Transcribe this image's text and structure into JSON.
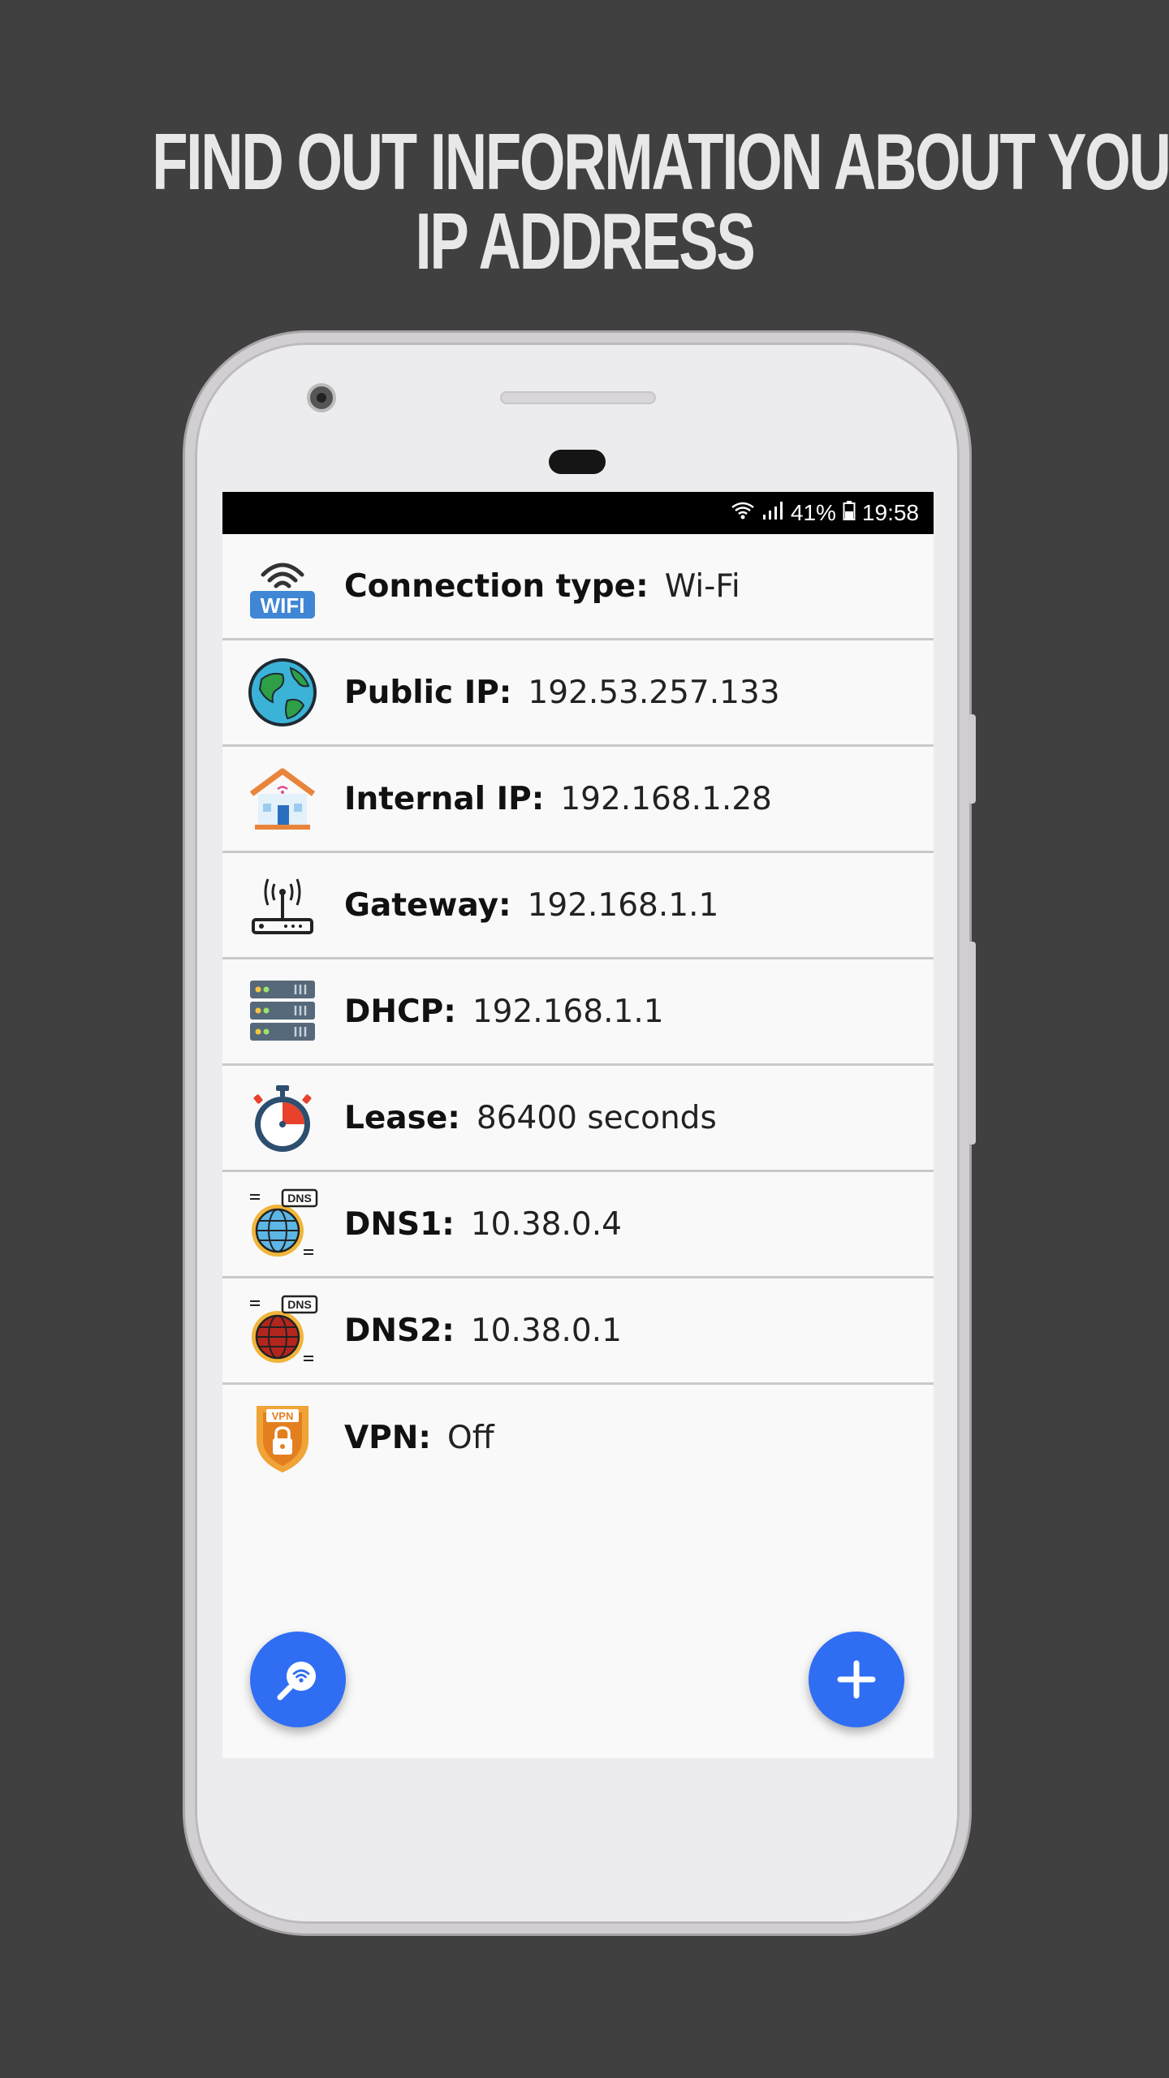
{
  "headline": {
    "line1": "FIND OUT INFORMATION ABOUT YOUR",
    "line2": "IP ADDRESS"
  },
  "status_bar": {
    "battery": "41%",
    "time": "19:58"
  },
  "rows": [
    {
      "icon": "wifi-icon",
      "label": "Connection type:",
      "value": "Wi-Fi"
    },
    {
      "icon": "globe-icon",
      "label": "Public IP:",
      "value": "192.53.257.133"
    },
    {
      "icon": "house-icon",
      "label": "Internal IP:",
      "value": "192.168.1.28"
    },
    {
      "icon": "router-icon",
      "label": "Gateway:",
      "value": "192.168.1.1"
    },
    {
      "icon": "server-icon",
      "label": "DHCP:",
      "value": "192.168.1.1"
    },
    {
      "icon": "stopwatch-icon",
      "label": "Lease:",
      "value": "86400 seconds"
    },
    {
      "icon": "dns-globe-blue-icon",
      "label": "DNS1:",
      "value": "10.38.0.4"
    },
    {
      "icon": "dns-globe-red-icon",
      "label": "DNS2:",
      "value": "10.38.0.1"
    },
    {
      "icon": "vpn-shield-icon",
      "label": "VPN:",
      "value": "Off"
    }
  ],
  "fab_left": {
    "icon": "wifi-search-icon"
  },
  "fab_right": {
    "icon": "plus-icon"
  },
  "colors": {
    "accent": "#2f6df3",
    "background": "#404040"
  }
}
